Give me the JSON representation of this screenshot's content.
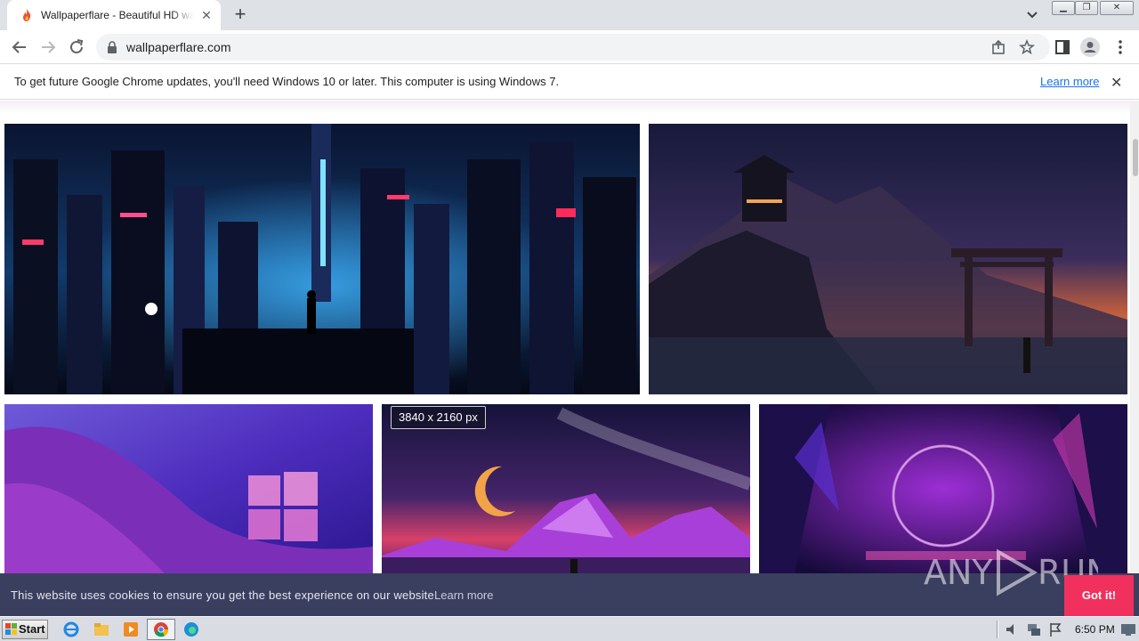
{
  "browser": {
    "tab_title": "Wallpaperflare - Beautiful HD wallpapers",
    "url": "wallpaperflare.com",
    "new_tab_label": "+",
    "tab_close": "✕"
  },
  "infobar": {
    "message": "To get future Google Chrome updates, you'll need Windows 10 or later. This computer is using Windows 7.",
    "link": "Learn more",
    "close": "✕"
  },
  "gallery": {
    "hover_badge": "3840 x 2160 px",
    "tiles": [
      {
        "name": "cyberpunk-city-wallpaper"
      },
      {
        "name": "japanese-temple-sunset-wallpaper"
      },
      {
        "name": "windows-11-purple-wallpaper"
      },
      {
        "name": "synthwave-moon-mountains-wallpaper"
      },
      {
        "name": "neon-circle-portal-wallpaper"
      }
    ]
  },
  "cookie_bar": {
    "message": "This website uses cookies to ensure you get the best experience on our website.",
    "link": "Learn more",
    "button": "Got it!"
  },
  "watermark": "ANY RUN",
  "taskbar": {
    "start_label": "Start",
    "clock": "6:50 PM"
  },
  "colors": {
    "cookie_bg": "#3b3f5f",
    "cookie_button": "#f1305d",
    "link_blue": "#1a73e8"
  }
}
